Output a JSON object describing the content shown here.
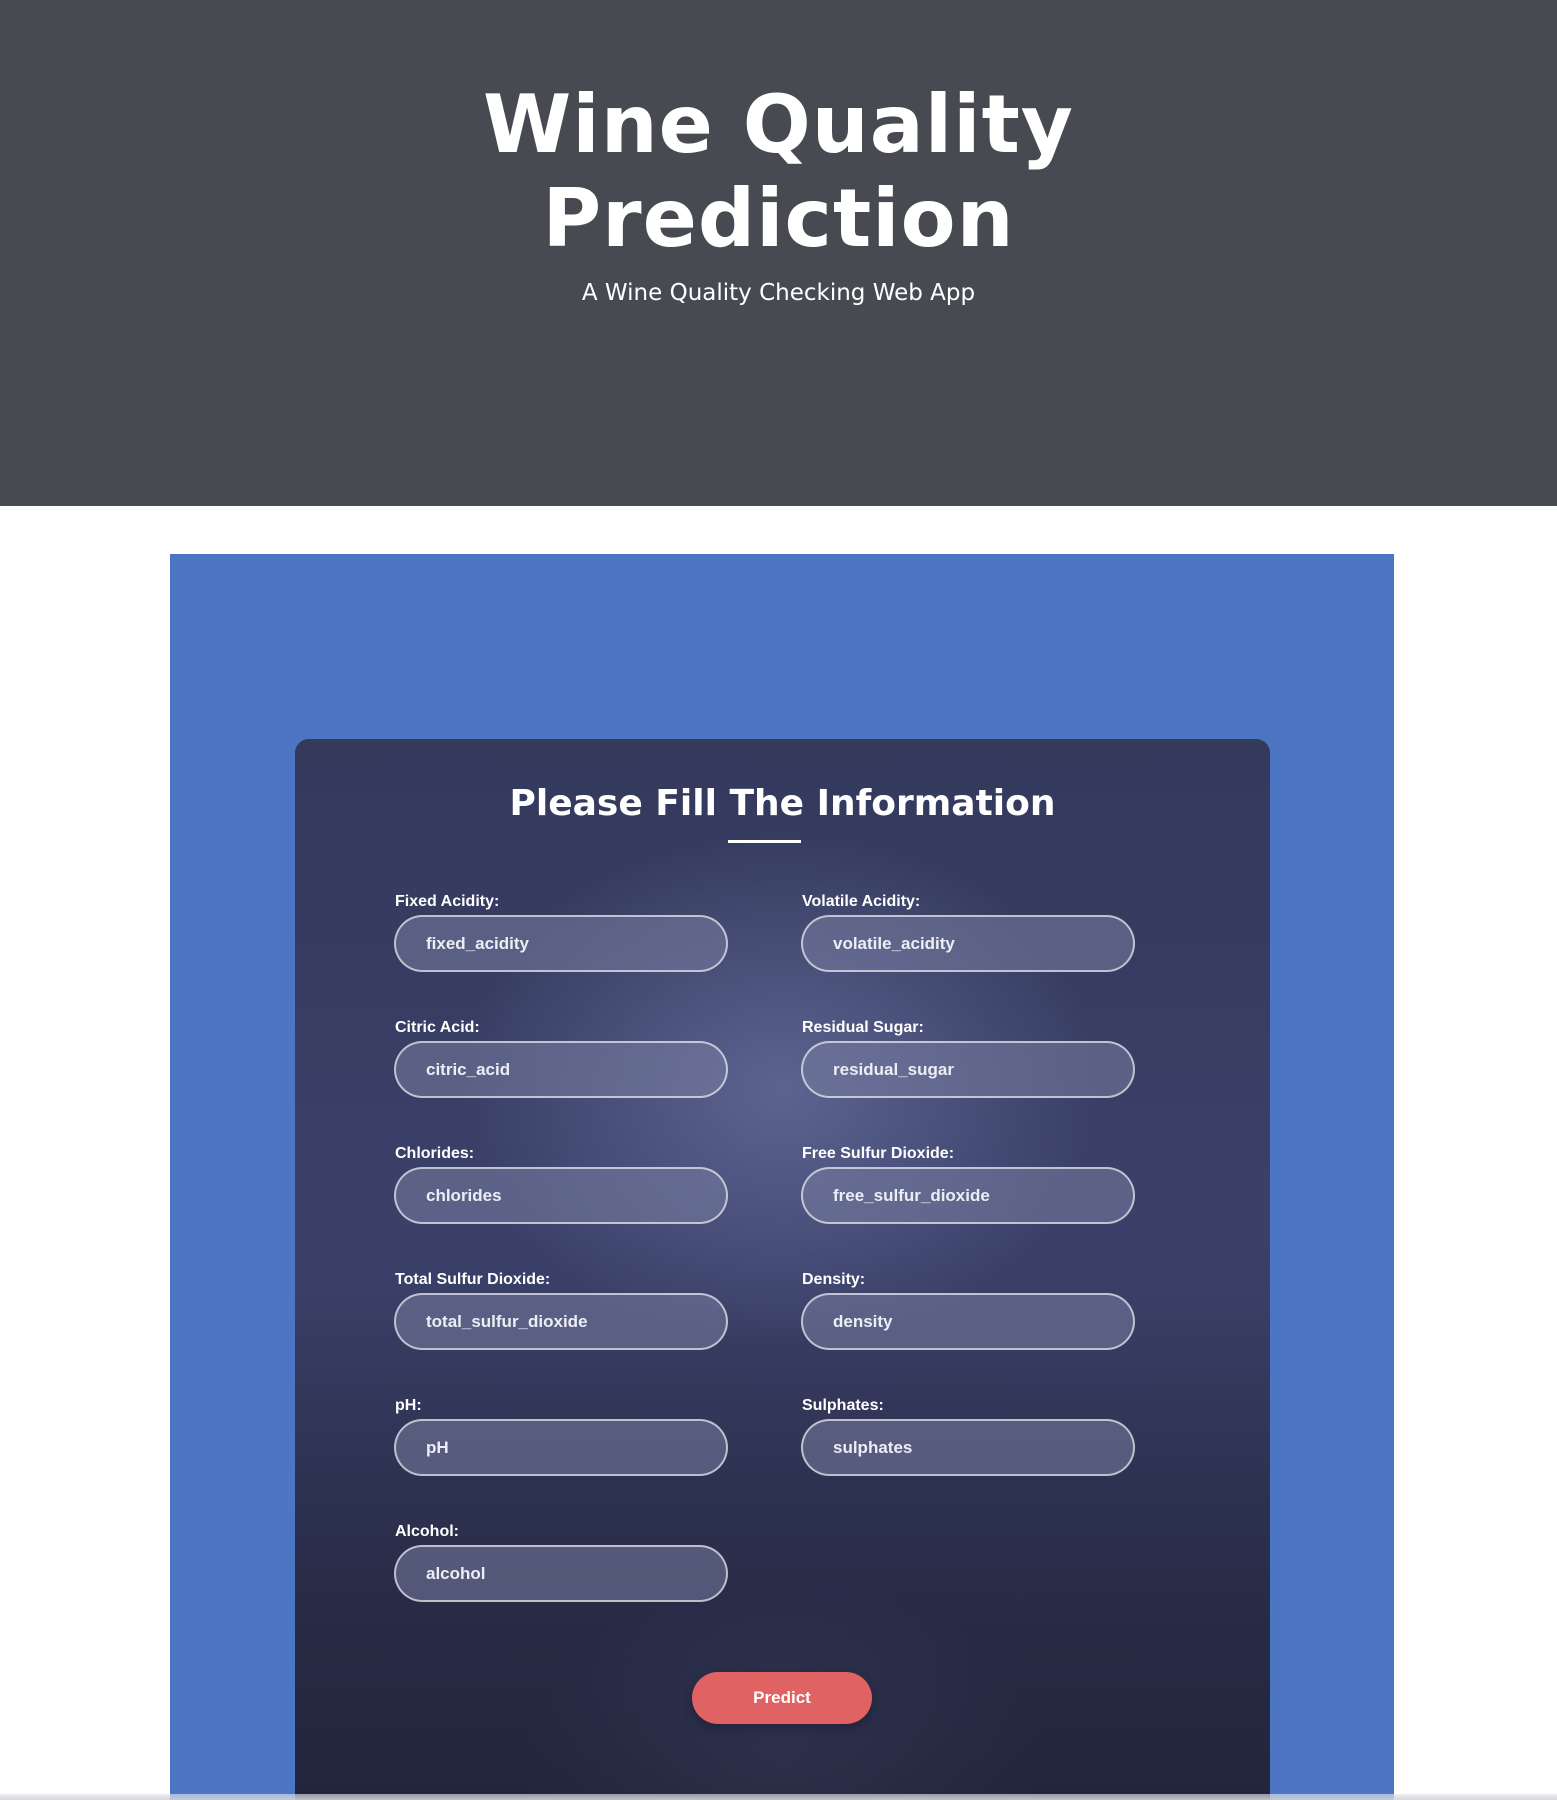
{
  "hero": {
    "title_line1": "Wine Quality",
    "title_line2": "Prediction",
    "subtitle": "A Wine Quality Checking Web App"
  },
  "form": {
    "title": "Please Fill The Information",
    "fields": [
      {
        "label": "Fixed Acidity:",
        "placeholder": "fixed_acidity",
        "value": ""
      },
      {
        "label": "Volatile Acidity:",
        "placeholder": "volatile_acidity",
        "value": ""
      },
      {
        "label": "Citric Acid:",
        "placeholder": "citric_acid",
        "value": ""
      },
      {
        "label": "Residual Sugar:",
        "placeholder": "residual_sugar",
        "value": ""
      },
      {
        "label": "Chlorides:",
        "placeholder": "chlorides",
        "value": ""
      },
      {
        "label": "Free Sulfur Dioxide:",
        "placeholder": "free_sulfur_dioxide",
        "value": ""
      },
      {
        "label": "Total Sulfur Dioxide:",
        "placeholder": "total_sulfur_dioxide",
        "value": ""
      },
      {
        "label": "Density:",
        "placeholder": "density",
        "value": ""
      },
      {
        "label": "pH:",
        "placeholder": "pH",
        "value": ""
      },
      {
        "label": "Sulphates:",
        "placeholder": "sulphates",
        "value": ""
      },
      {
        "label": "Alcohol:",
        "placeholder": "alcohol",
        "value": ""
      }
    ],
    "submit_label": "Predict"
  },
  "colors": {
    "hero_bg": "#484a52",
    "panel_bg": "#4c75c4",
    "card_bg": "#363b5e",
    "button_bg": "#e06262"
  }
}
